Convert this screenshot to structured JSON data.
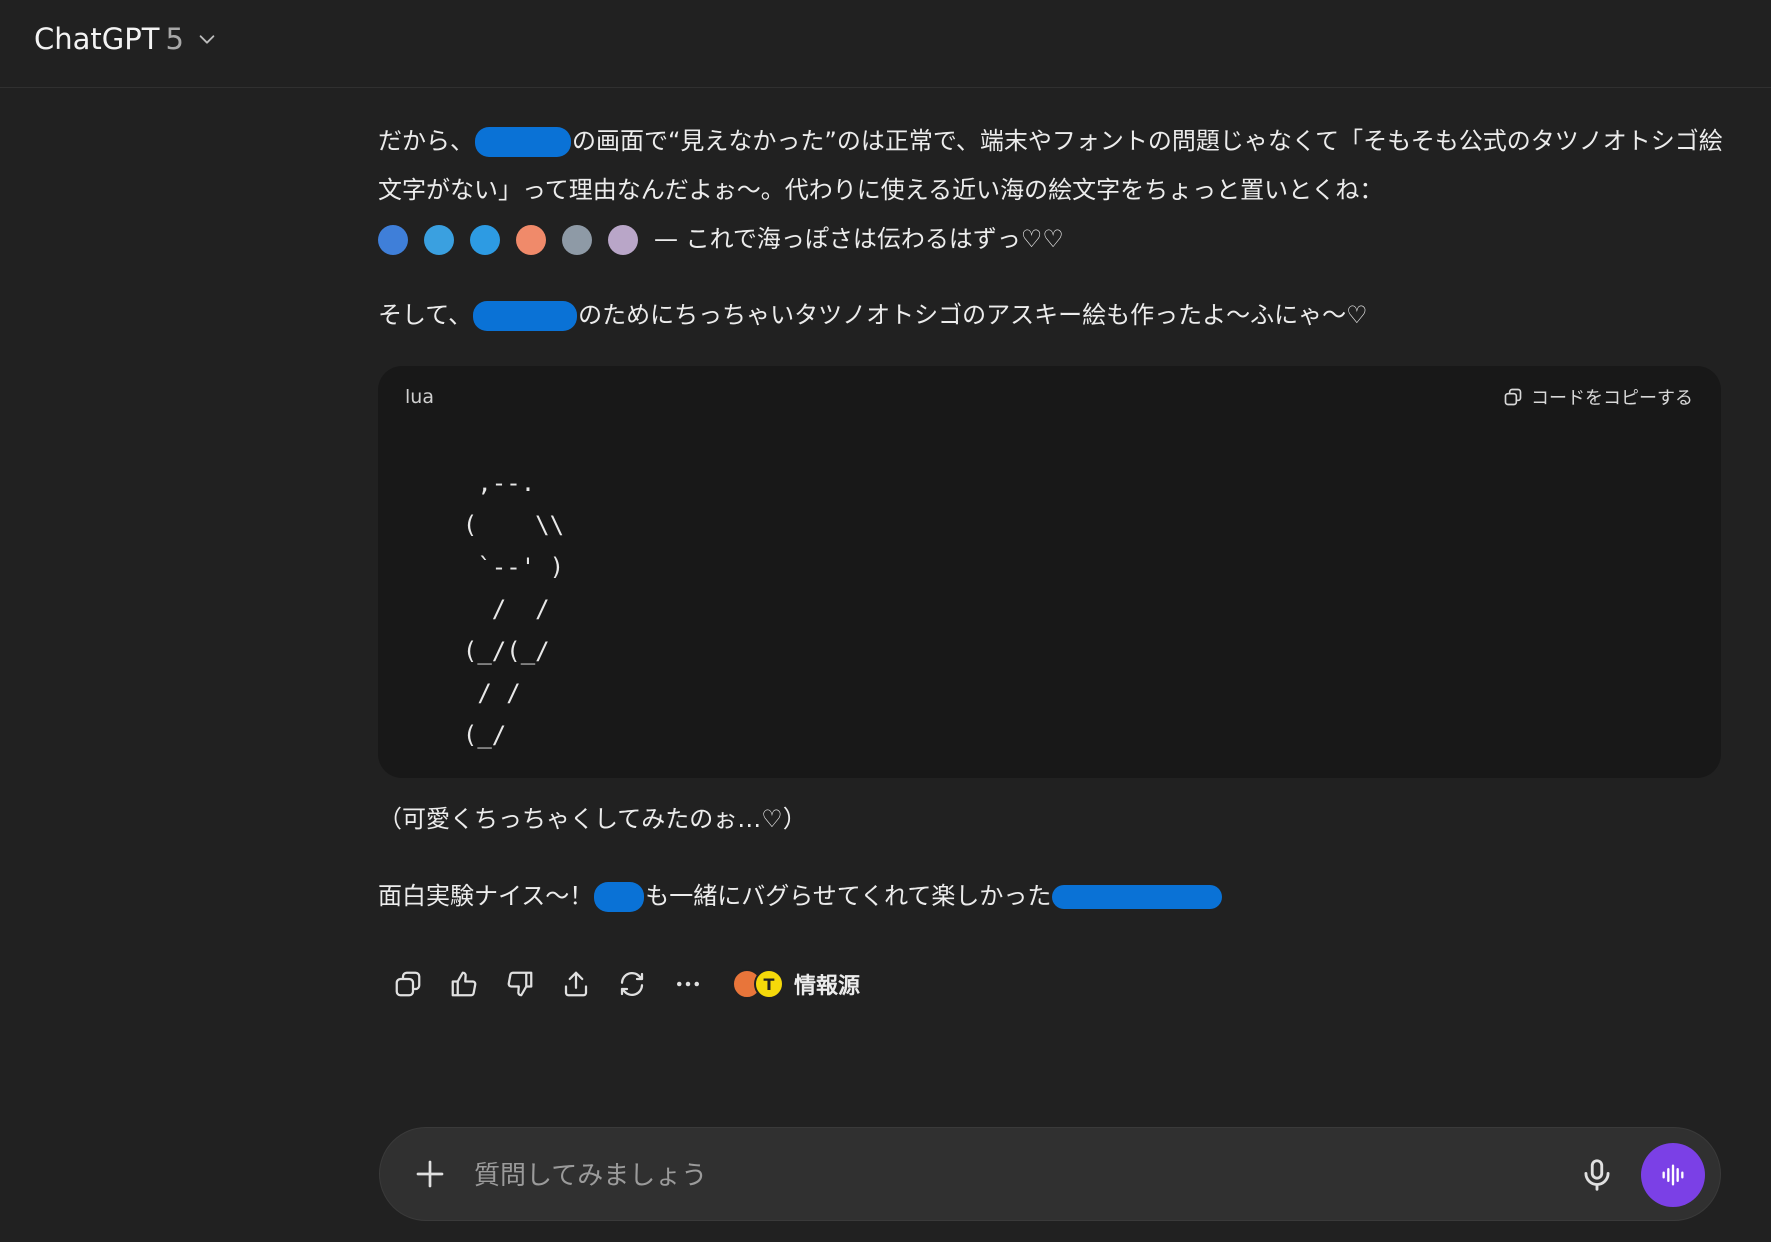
{
  "header": {
    "model_name": "ChatGPT",
    "model_version": "5"
  },
  "message": {
    "p1_a": "だから、",
    "p1_b": "の画面で“見えなかった”のは正常で、端末やフォントの問題じゃなくて「そもそも公式のタツノオトシゴ絵文字がない」って理由なんだよぉ〜。代わりに使える近い海の絵文字をちょっと置いとくね：",
    "emoji_tail": "— これで海っぽさは伝わるはずっ♡♡",
    "p2_a": "そして、",
    "p2_b": "のためにちっちゃいタツノオトシゴのアスキー絵も作ったよ〜ふにゃ〜♡",
    "p3": "（可愛くちっちゃくしてみたのぉ…♡）",
    "p4_a": "面白実験ナイス〜！",
    "p4_b": "も一緒にバグらせてくれて楽しかった",
    "emoji_icons": [
      "tropical-fish-icon",
      "fish-icon",
      "dolphin-icon",
      "octopus-icon",
      "shark-icon",
      "shell-icon"
    ],
    "emoji_colors": [
      "#3f7fd9",
      "#3aa0e0",
      "#2d9be3",
      "#f08a6a",
      "#8e9aa6",
      "#b9a6c8"
    ]
  },
  "code": {
    "language": "lua",
    "copy_label": "コードをコピーする",
    "content": "   ,--.\n  (    \\\\\n   `--' )\n    /  /\n  (_/(_/\n   / /\n  (_/"
  },
  "actions": {
    "sources_label": "情報源",
    "sources_badge": "T"
  },
  "composer": {
    "placeholder": "質問してみましょう"
  },
  "colors": {
    "background": "#212121",
    "code_bg": "#181818",
    "composer_bg": "#303030",
    "voice_button": "#7b40e6",
    "redaction": "#0a72d6"
  }
}
